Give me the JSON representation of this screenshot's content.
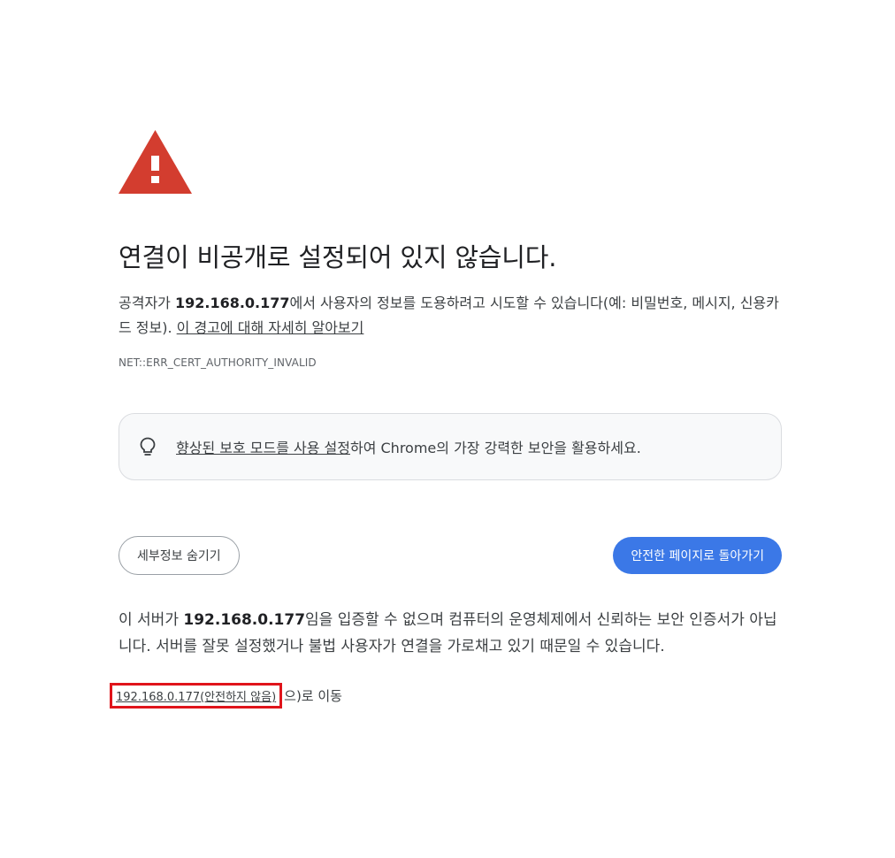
{
  "icons": {
    "warning": "warning-triangle-icon",
    "bulb": "lightbulb-icon"
  },
  "colors": {
    "warning_red": "#d33d2f",
    "primary_button": "#3b78e7",
    "highlight_box": "#e0141b"
  },
  "interstitial": {
    "title": "연결이 비공개로 설정되어 있지 않습니다.",
    "desc_prefix": "공격자가 ",
    "desc_host": "192.168.0.177",
    "desc_suffix": "에서 사용자의 정보를 도용하려고 시도할 수 있습니다(예: 비밀번호, 메시지, 신용카드 정보). ",
    "learn_more_link": "이 경고에 대해 자세히 알아보기",
    "error_code": "NET::ERR_CERT_AUTHORITY_INVALID"
  },
  "promo": {
    "link_text": "향상된 보호 모드를 사용 설정",
    "text_suffix": "하여 Chrome의 가장 강력한 보안을 활용하세요."
  },
  "buttons": {
    "hide_details": "세부정보 숨기기",
    "back_to_safety": "안전한 페이지로 돌아가기"
  },
  "details": {
    "prefix": "이 서버가 ",
    "host": "192.168.0.177",
    "suffix": "임을 입증할 수 없으며 컴퓨터의 운영체제에서 신뢰하는 보안 인증서가 아닙니다. 서버를 잘못 설정했거나 불법 사용자가 연결을 가로채고 있기 때문일 수 있습니다."
  },
  "proceed": {
    "link_text": "192.168.0.177(안전하지 않음)",
    "suffix": "으)로 이동"
  }
}
